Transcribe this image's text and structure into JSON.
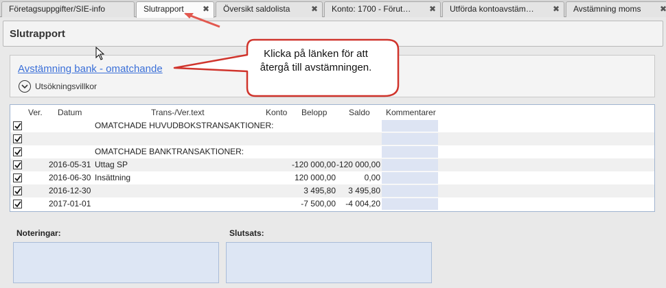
{
  "tabs": [
    {
      "label": "Företagsuppgifter/SIE-info",
      "close": ""
    },
    {
      "label": "Slutrapport",
      "close": "✖"
    },
    {
      "label": "Översikt saldolista",
      "close": "✖"
    },
    {
      "label": "Konto: 1700 - Förut…",
      "close": "✖"
    },
    {
      "label": "Utförda kontoavstäm…",
      "close": "✖"
    },
    {
      "label": "Avstämning moms",
      "close": "✖"
    }
  ],
  "page_title": "Slutrapport",
  "link_text": "Avstämning bank - omatchande",
  "criteria_label": "Utsökningsvillkor",
  "callout_text": "Klicka på länken för att återgå till avstämningen.",
  "columns": {
    "ver": "Ver.",
    "datum": "Datum",
    "text": "Trans-/Ver.text",
    "konto": "Konto",
    "belopp": "Belopp",
    "saldo": "Saldo",
    "kommentarer": "Kommentarer"
  },
  "rows": [
    {
      "checked": true,
      "ver": "",
      "datum": "",
      "text": "OMATCHADE HUVUDBOKSTRANSAKTIONER:",
      "konto": "",
      "belopp": "",
      "saldo": ""
    },
    {
      "checked": true,
      "ver": "",
      "datum": "",
      "text": "",
      "konto": "",
      "belopp": "",
      "saldo": ""
    },
    {
      "checked": true,
      "ver": "",
      "datum": "",
      "text": "OMATCHADE BANKTRANSAKTIONER:",
      "konto": "",
      "belopp": "",
      "saldo": ""
    },
    {
      "checked": true,
      "ver": "",
      "datum": "2016-05-31",
      "text": "Uttag SP",
      "konto": "",
      "belopp": "-120 000,00",
      "saldo": "-120 000,00"
    },
    {
      "checked": true,
      "ver": "",
      "datum": "2016-06-30",
      "text": "Insättning",
      "konto": "",
      "belopp": "120 000,00",
      "saldo": "0,00"
    },
    {
      "checked": true,
      "ver": "",
      "datum": "2016-12-30",
      "text": "",
      "konto": "",
      "belopp": "3 495,80",
      "saldo": "3 495,80"
    },
    {
      "checked": true,
      "ver": "",
      "datum": "2017-01-01",
      "text": "",
      "konto": "",
      "belopp": "-7 500,00",
      "saldo": "-4 004,20"
    }
  ],
  "notes": {
    "label": "Noteringar:",
    "value": ""
  },
  "conclusion": {
    "label": "Slutsats:",
    "value": ""
  },
  "colors": {
    "link": "#3a6fd8",
    "callout_border": "#d0342c",
    "comment_cell": "#dde4f3"
  }
}
